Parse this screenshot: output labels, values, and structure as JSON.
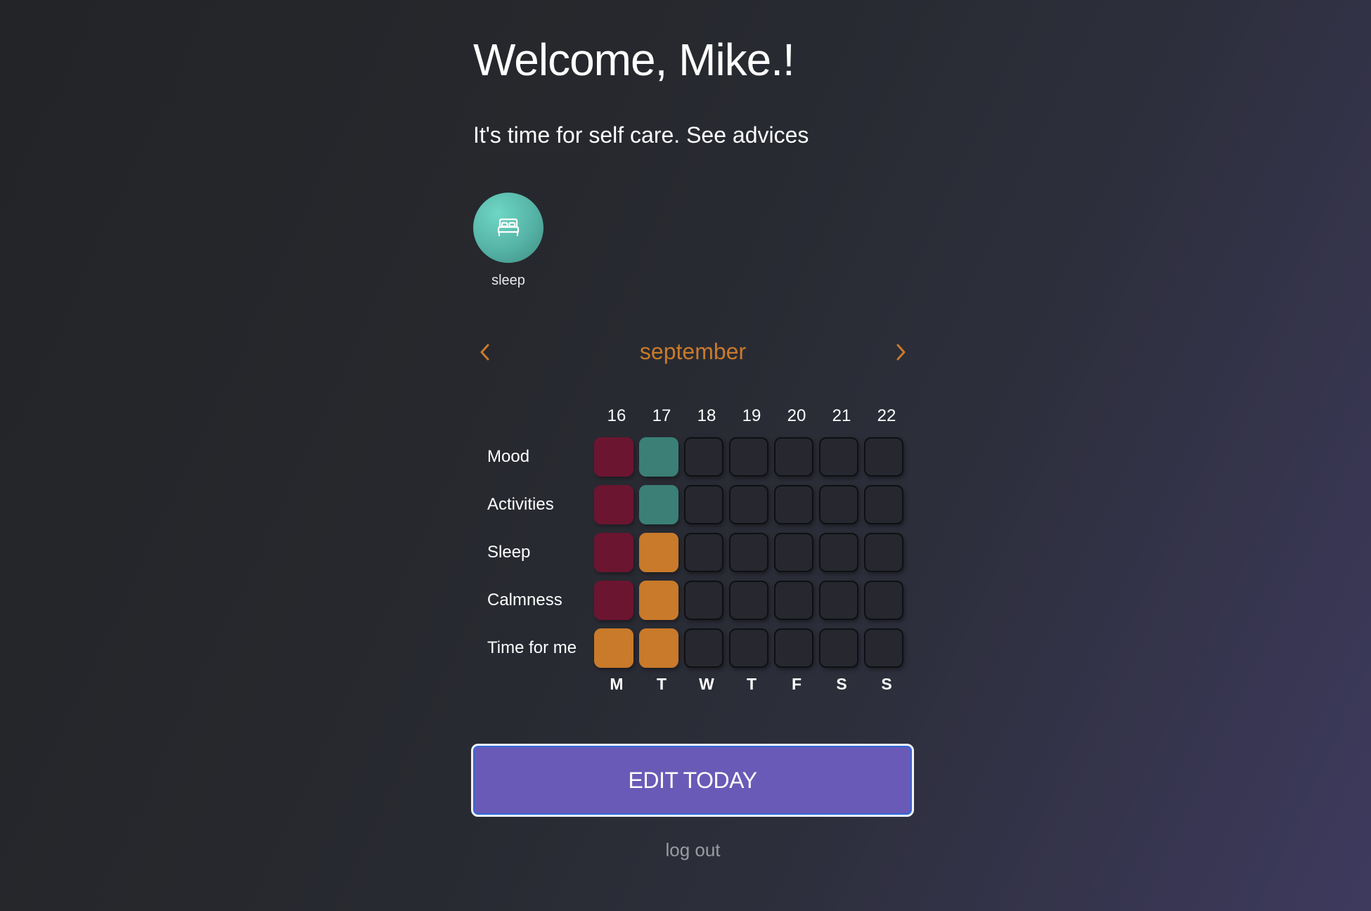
{
  "header": {
    "title": "Welcome, Mike.!",
    "subtitle": "It's time for self care. See advices"
  },
  "advices": [
    {
      "label": "sleep",
      "icon": "bed-icon",
      "color": "#55b3a5"
    }
  ],
  "calendar": {
    "month": "september",
    "prev_icon": "chevron-left-icon",
    "next_icon": "chevron-right-icon",
    "dates": [
      "16",
      "17",
      "18",
      "19",
      "20",
      "21",
      "22"
    ],
    "weekdays": [
      "M",
      "T",
      "W",
      "T",
      "F",
      "S",
      "S"
    ],
    "rows": [
      {
        "label": "Mood",
        "cells": [
          "red",
          "teal",
          "empty",
          "empty",
          "empty",
          "empty",
          "empty"
        ]
      },
      {
        "label": "Activities",
        "cells": [
          "red",
          "teal",
          "empty",
          "empty",
          "empty",
          "empty",
          "empty"
        ]
      },
      {
        "label": "Sleep",
        "cells": [
          "red",
          "orange",
          "empty",
          "empty",
          "empty",
          "empty",
          "empty"
        ]
      },
      {
        "label": "Calmness",
        "cells": [
          "red",
          "orange",
          "empty",
          "empty",
          "empty",
          "empty",
          "empty"
        ]
      },
      {
        "label": "Time for me",
        "cells": [
          "orange",
          "orange",
          "empty",
          "empty",
          "empty",
          "empty",
          "empty"
        ]
      }
    ],
    "colors": {
      "red": "#6c1530",
      "teal": "#3b7f76",
      "orange": "#c97a2a",
      "empty": "#27282f"
    }
  },
  "actions": {
    "edit_label": "EDIT TODAY",
    "logout_label": "log out"
  }
}
